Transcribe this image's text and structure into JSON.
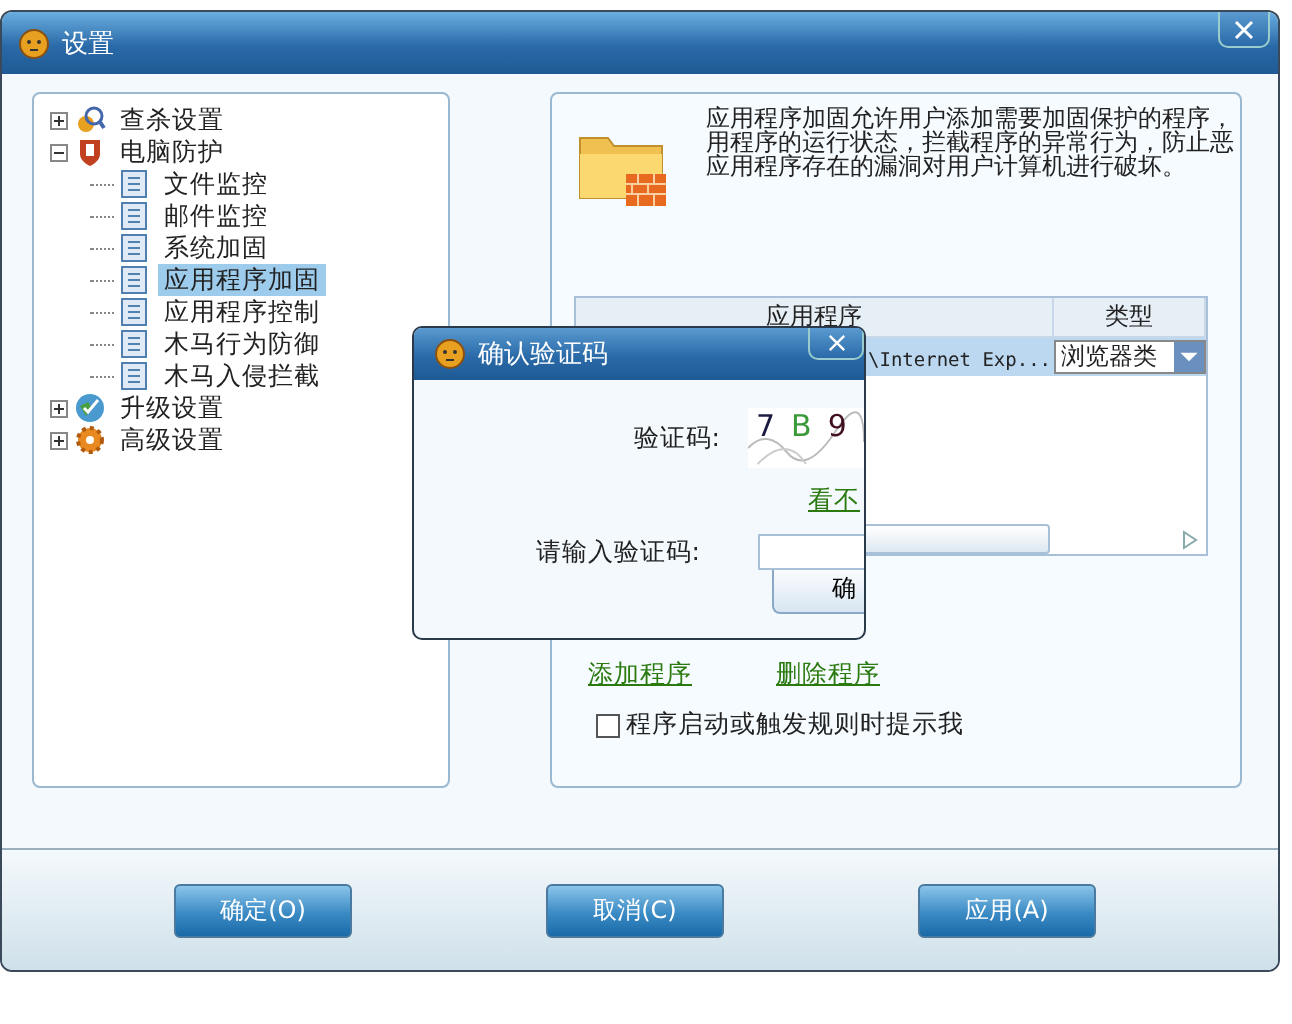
{
  "window": {
    "title": "设置"
  },
  "tree": [
    {
      "label": "查杀设置",
      "kind": "search",
      "expanded": false,
      "selected": false
    },
    {
      "label": "电脑防护",
      "kind": "shield",
      "expanded": true,
      "selected": false,
      "children": [
        {
          "label": "文件监控",
          "selected": false
        },
        {
          "label": "邮件监控",
          "selected": false
        },
        {
          "label": "系统加固",
          "selected": false
        },
        {
          "label": "应用程序加固",
          "selected": true
        },
        {
          "label": "应用程序控制",
          "selected": false
        },
        {
          "label": "木马行为防御",
          "selected": false
        },
        {
          "label": "木马入侵拦截",
          "selected": false
        }
      ]
    },
    {
      "label": "升级设置",
      "kind": "globe",
      "expanded": false,
      "selected": false
    },
    {
      "label": "高级设置",
      "kind": "gear",
      "expanded": false,
      "selected": false
    }
  ],
  "description": [
    "应用程序加固允许用户添加需要加固保护的程序，",
    "用程序的运行状态，拦截程序的异常行为，防止恶",
    "应用程序存在的漏洞对用户计算机进行破坏。"
  ],
  "table": {
    "columns": [
      "应用程序",
      "类型"
    ],
    "rows": [
      {
        "program": "\\Internet Exp...",
        "type": "浏览器类",
        "selected": true
      }
    ]
  },
  "links": [
    "添加程序",
    "删除程序"
  ],
  "prompt_checkbox": {
    "label": "程序启动或触发规则时提示我",
    "checked": false
  },
  "buttons": [
    "确定(O)",
    "取消(C)",
    "应用(A)"
  ],
  "dialog": {
    "title": "确认验证码",
    "code_label": "验证码:",
    "captcha": [
      {
        "char": "7",
        "color": "#1a1a40"
      },
      {
        "char": "B",
        "color": "#3a9a3a"
      },
      {
        "char": "9",
        "color": "#401020"
      }
    ],
    "refresh_link": "看不",
    "input_label": "请输入验证码:",
    "button": "确"
  }
}
